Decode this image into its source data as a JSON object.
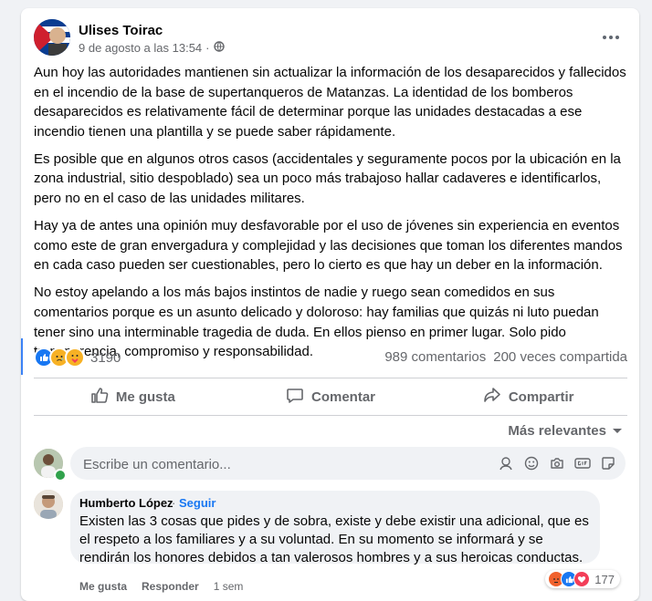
{
  "post": {
    "author": "Ulises Toirac",
    "timestamp": "9 de agosto a las 13:54",
    "separator": "·",
    "paragraphs": [
      "Aun hoy las autoridades mantienen sin actualizar la información de los desaparecidos y fallecidos en el incendio de la base de supertanqueros de Matanzas. La identidad de los bomberos desaparecidos es relativamente fácil de determinar porque las unidades destacadas a ese incendio tienen una plantilla y se puede saber rápidamente.",
      "Es posible que en algunos otros casos (accidentales y seguramente pocos por la ubicación en la zona industrial, sitio despoblado) sea un poco más trabajoso hallar cadaveres e identificarlos, pero no en el caso de las unidades militares.",
      "Hay ya de antes una opinión muy desfavorable por el uso de jóvenes sin experiencia en eventos como este de gran envergadura y complejidad y las decisiones que toman los diferentes mandos en cada caso pueden ser cuestionables, pero lo cierto es que hay un deber en la información.",
      "No estoy apelando a los más bajos instintos de nadie y ruego sean comedidos en sus comentarios porque es un asunto delicado y doloroso: hay familias que quizás ni luto puedan tener sino una interminable tragedia de duda. En ellos pienso en primer lugar. Solo pido transparencia, compromiso y responsabilidad."
    ],
    "reaction_count": "3190",
    "comments_count": "989 comentarios",
    "shares_count": "200 veces compartida",
    "reaction_icons": [
      "like-icon",
      "sad-icon",
      "care-icon"
    ]
  },
  "actions": {
    "like": "Me gusta",
    "comment": "Comentar",
    "share": "Compartir"
  },
  "sort": {
    "label": "Más relevantes"
  },
  "composer": {
    "placeholder": "Escribe un comentario..."
  },
  "comment": {
    "author": "Humberto López",
    "separator": "·",
    "follow": "Seguir",
    "text": "Existen las 3 cosas que pides y de sobra, existe y debe existir una adicional, que es el respeto a los familiares y a su voluntad. En su momento se informará y se rendirán los honores debidos a tan valerosos hombres y a sus heroicas conductas.",
    "like": "Me gusta",
    "reply": "Responder",
    "time": "1 sem",
    "reaction_count": "177"
  },
  "colors": {
    "accent": "#1877f2",
    "secondary_text": "#65676b",
    "background": "#f0f2f5"
  }
}
